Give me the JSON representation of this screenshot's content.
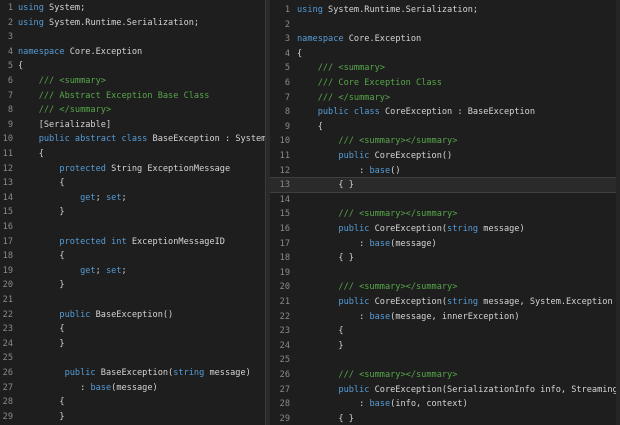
{
  "left_pane": {
    "lines": [
      {
        "n": "1",
        "t": [
          {
            "c": "kw",
            "s": "using"
          },
          {
            "c": "",
            "s": " System;"
          }
        ]
      },
      {
        "n": "2",
        "t": [
          {
            "c": "kw",
            "s": "using"
          },
          {
            "c": "",
            "s": " System.Runtime.Serialization;"
          }
        ]
      },
      {
        "n": "3",
        "t": []
      },
      {
        "n": "4",
        "t": [
          {
            "c": "kw",
            "s": "namespace"
          },
          {
            "c": "",
            "s": " Core.Exception"
          }
        ]
      },
      {
        "n": "5",
        "t": [
          {
            "c": "",
            "s": "{"
          }
        ]
      },
      {
        "n": "6",
        "t": [
          {
            "c": "cm",
            "s": "    /// <summary>"
          }
        ]
      },
      {
        "n": "7",
        "t": [
          {
            "c": "cm",
            "s": "    /// Abstract Exception Base Class"
          }
        ]
      },
      {
        "n": "8",
        "t": [
          {
            "c": "cm",
            "s": "    /// </summary>"
          }
        ]
      },
      {
        "n": "9",
        "t": [
          {
            "c": "",
            "s": "    [Serializable]"
          }
        ]
      },
      {
        "n": "10",
        "t": [
          {
            "c": "kw",
            "s": "    public abstract class"
          },
          {
            "c": "",
            "s": " BaseException : System.Exception"
          }
        ]
      },
      {
        "n": "11",
        "t": [
          {
            "c": "",
            "s": "    {"
          }
        ]
      },
      {
        "n": "12",
        "t": [
          {
            "c": "kw",
            "s": "        protected"
          },
          {
            "c": "",
            "s": " String ExceptionMessage"
          }
        ]
      },
      {
        "n": "13",
        "t": [
          {
            "c": "",
            "s": "        {"
          }
        ]
      },
      {
        "n": "14",
        "t": [
          {
            "c": "kw",
            "s": "            get"
          },
          {
            "c": "",
            "s": "; "
          },
          {
            "c": "kw",
            "s": "set"
          },
          {
            "c": "",
            "s": ";"
          }
        ]
      },
      {
        "n": "15",
        "t": [
          {
            "c": "",
            "s": "        }"
          }
        ]
      },
      {
        "n": "16",
        "t": []
      },
      {
        "n": "17",
        "t": [
          {
            "c": "kw",
            "s": "        protected int"
          },
          {
            "c": "",
            "s": " ExceptionMessageID"
          }
        ]
      },
      {
        "n": "18",
        "t": [
          {
            "c": "",
            "s": "        {"
          }
        ]
      },
      {
        "n": "19",
        "t": [
          {
            "c": "kw",
            "s": "            get"
          },
          {
            "c": "",
            "s": "; "
          },
          {
            "c": "kw",
            "s": "set"
          },
          {
            "c": "",
            "s": ";"
          }
        ]
      },
      {
        "n": "20",
        "t": [
          {
            "c": "",
            "s": "        }"
          }
        ]
      },
      {
        "n": "21",
        "t": []
      },
      {
        "n": "22",
        "t": [
          {
            "c": "kw",
            "s": "        public"
          },
          {
            "c": "",
            "s": " BaseException()"
          }
        ]
      },
      {
        "n": "23",
        "t": [
          {
            "c": "",
            "s": "        {"
          }
        ]
      },
      {
        "n": "24",
        "t": [
          {
            "c": "",
            "s": "        }"
          }
        ]
      },
      {
        "n": "25",
        "t": []
      },
      {
        "n": "26",
        "t": [
          {
            "c": "kw",
            "s": "         public"
          },
          {
            "c": "",
            "s": " BaseException("
          },
          {
            "c": "kw",
            "s": "string"
          },
          {
            "c": "",
            "s": " message)"
          }
        ]
      },
      {
        "n": "27",
        "t": [
          {
            "c": "",
            "s": "            : "
          },
          {
            "c": "kw",
            "s": "base"
          },
          {
            "c": "",
            "s": "(message)"
          }
        ]
      },
      {
        "n": "28",
        "t": [
          {
            "c": "",
            "s": "        {"
          }
        ]
      },
      {
        "n": "29",
        "t": [
          {
            "c": "",
            "s": "        }"
          }
        ]
      }
    ]
  },
  "right_pane": {
    "lines": [
      {
        "n": "1",
        "t": [
          {
            "c": "kw",
            "s": "using"
          },
          {
            "c": "",
            "s": " System.Runtime.Serialization;"
          }
        ]
      },
      {
        "n": "2",
        "t": []
      },
      {
        "n": "3",
        "t": [
          {
            "c": "kw",
            "s": "namespace"
          },
          {
            "c": "",
            "s": " Core.Exception"
          }
        ]
      },
      {
        "n": "4",
        "t": [
          {
            "c": "",
            "s": "{"
          }
        ]
      },
      {
        "n": "5",
        "t": [
          {
            "c": "cm",
            "s": "    /// <summary>"
          }
        ]
      },
      {
        "n": "6",
        "t": [
          {
            "c": "cm",
            "s": "    /// Core Exception Class"
          }
        ]
      },
      {
        "n": "7",
        "t": [
          {
            "c": "cm",
            "s": "    /// </summary>"
          }
        ]
      },
      {
        "n": "8",
        "t": [
          {
            "c": "kw",
            "s": "    public class"
          },
          {
            "c": "",
            "s": " CoreException : BaseException"
          }
        ]
      },
      {
        "n": "9",
        "t": [
          {
            "c": "",
            "s": "    {"
          }
        ]
      },
      {
        "n": "10",
        "t": [
          {
            "c": "cm",
            "s": "        /// <summary></summary>"
          }
        ]
      },
      {
        "n": "11",
        "t": [
          {
            "c": "kw",
            "s": "        public"
          },
          {
            "c": "",
            "s": " CoreException()"
          }
        ]
      },
      {
        "n": "12",
        "t": [
          {
            "c": "",
            "s": "            : "
          },
          {
            "c": "kw",
            "s": "base"
          },
          {
            "c": "",
            "s": "()"
          }
        ]
      },
      {
        "n": "13",
        "t": [
          {
            "c": "",
            "s": "        { }"
          }
        ],
        "cur": true
      },
      {
        "n": "14",
        "t": []
      },
      {
        "n": "15",
        "t": [
          {
            "c": "cm",
            "s": "        /// <summary></summary>"
          }
        ]
      },
      {
        "n": "16",
        "t": [
          {
            "c": "kw",
            "s": "        public"
          },
          {
            "c": "",
            "s": " CoreException("
          },
          {
            "c": "kw",
            "s": "string"
          },
          {
            "c": "",
            "s": " message)"
          }
        ]
      },
      {
        "n": "17",
        "t": [
          {
            "c": "",
            "s": "            : "
          },
          {
            "c": "kw",
            "s": "base"
          },
          {
            "c": "",
            "s": "(message)"
          }
        ]
      },
      {
        "n": "18",
        "t": [
          {
            "c": "",
            "s": "        { }"
          }
        ]
      },
      {
        "n": "19",
        "t": []
      },
      {
        "n": "20",
        "t": [
          {
            "c": "cm",
            "s": "        /// <summary></summary>"
          }
        ]
      },
      {
        "n": "21",
        "t": [
          {
            "c": "kw",
            "s": "        public"
          },
          {
            "c": "",
            "s": " CoreException("
          },
          {
            "c": "kw",
            "s": "string"
          },
          {
            "c": "",
            "s": " message, System.Exception innerException)"
          }
        ]
      },
      {
        "n": "22",
        "t": [
          {
            "c": "",
            "s": "            : "
          },
          {
            "c": "kw",
            "s": "base"
          },
          {
            "c": "",
            "s": "(message, innerException)"
          }
        ]
      },
      {
        "n": "23",
        "t": [
          {
            "c": "",
            "s": "        {"
          }
        ]
      },
      {
        "n": "24",
        "t": [
          {
            "c": "",
            "s": "        }"
          }
        ]
      },
      {
        "n": "25",
        "t": []
      },
      {
        "n": "26",
        "t": [
          {
            "c": "cm",
            "s": "        /// <summary></summary>"
          }
        ]
      },
      {
        "n": "27",
        "t": [
          {
            "c": "kw",
            "s": "        public"
          },
          {
            "c": "",
            "s": " CoreException(SerializationInfo info, StreamingContext context)"
          }
        ]
      },
      {
        "n": "28",
        "t": [
          {
            "c": "",
            "s": "            : "
          },
          {
            "c": "kw",
            "s": "base"
          },
          {
            "c": "",
            "s": "(info, context)"
          }
        ]
      },
      {
        "n": "29",
        "t": [
          {
            "c": "",
            "s": "        { }"
          }
        ]
      }
    ]
  }
}
